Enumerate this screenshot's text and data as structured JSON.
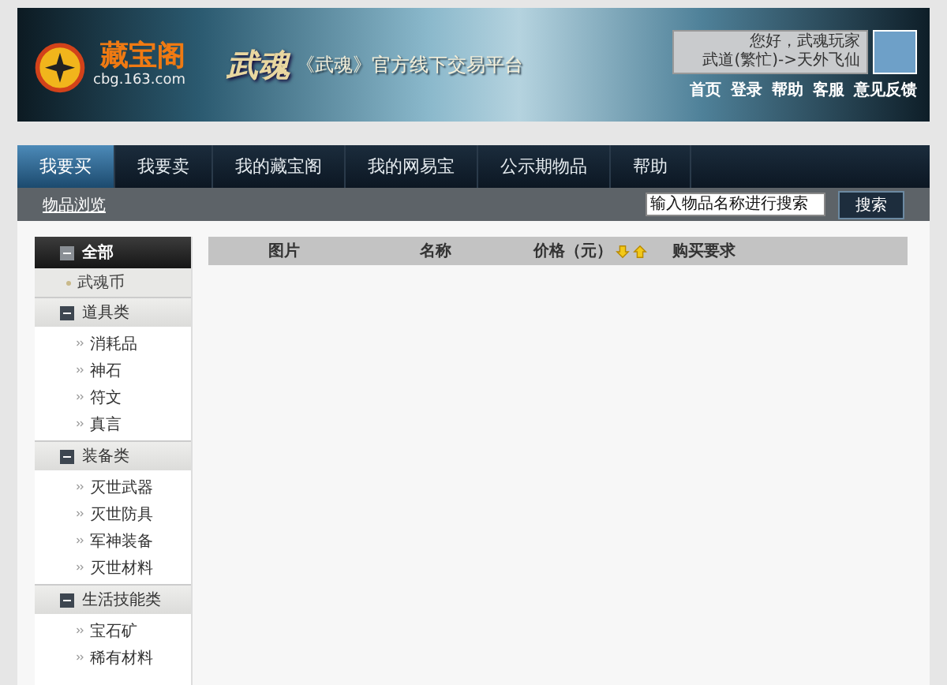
{
  "banner": {
    "logo_text": "藏宝阁",
    "logo_url": "cbg.163.com",
    "game_logo": "武魂",
    "slogan": "《武魂》官方线下交易平台",
    "greeting": "您好，武魂玩家",
    "server": "武道(繁忙)->天外飞仙",
    "links": [
      "首页",
      "登录",
      "帮助",
      "客服",
      "意见反馈"
    ]
  },
  "tabs": [
    {
      "label": "我要买",
      "selected": true
    },
    {
      "label": "我要卖",
      "selected": false
    },
    {
      "label": "我的藏宝阁",
      "selected": false
    },
    {
      "label": "我的网易宝",
      "selected": false
    },
    {
      "label": "公示期物品",
      "selected": false
    },
    {
      "label": "帮助",
      "selected": false
    }
  ],
  "breadcrumb": "物品浏览",
  "search": {
    "placeholder": "输入物品名称进行搜索",
    "button": "搜索"
  },
  "sidebar": [
    {
      "kind": "all",
      "label": "全部"
    },
    {
      "kind": "item",
      "label": "武魂币"
    },
    {
      "kind": "category",
      "label": "道具类",
      "expanded": true,
      "children": [
        "消耗品",
        "神石",
        "符文",
        "真言"
      ]
    },
    {
      "kind": "category",
      "label": "装备类",
      "expanded": true,
      "children": [
        "灭世武器",
        "灭世防具",
        "军神装备",
        "灭世材料"
      ]
    },
    {
      "kind": "category",
      "label": "生活技能类",
      "expanded": true,
      "children": [
        "宝石矿",
        "稀有材料"
      ]
    }
  ],
  "table": {
    "columns": [
      {
        "label": "图片",
        "kind": "plain"
      },
      {
        "label": "名称",
        "kind": "plain"
      },
      {
        "label": "价格（元）",
        "kind": "sortable"
      },
      {
        "label": "购买要求",
        "kind": "plain"
      }
    ]
  }
}
